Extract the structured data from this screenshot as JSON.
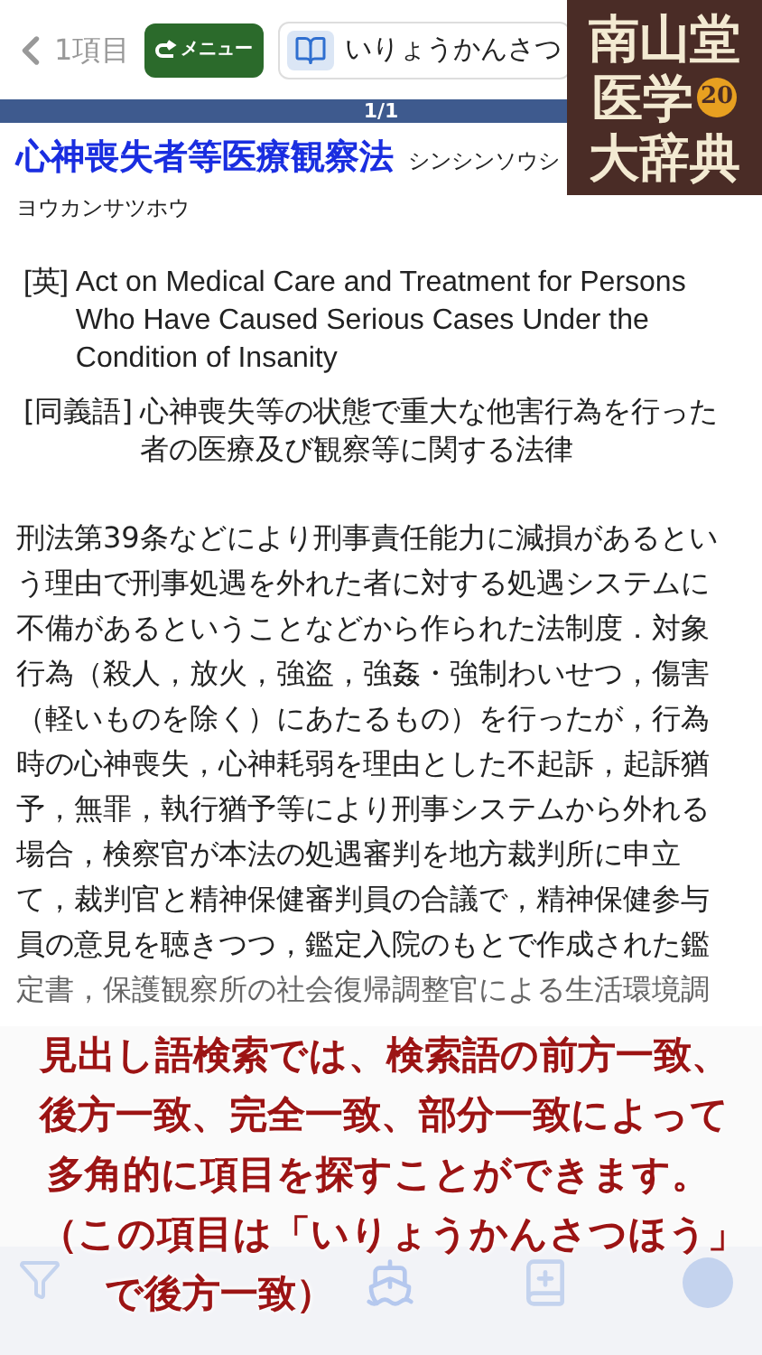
{
  "nav": {
    "back_label": "1項目",
    "menu_button": "メニュー",
    "search_value": "いりょうかんさつ"
  },
  "logo": {
    "line_1": "南山堂",
    "line_2": "医学",
    "edition": "20",
    "line_3": "大辞典"
  },
  "pager": {
    "label": "1/1"
  },
  "entry": {
    "title": "心神喪失者等医療観察法",
    "reading_start": "シンシンソウシ",
    "reading_end": "ヨウカンサツホウ",
    "english_tag": "[英]",
    "english": "Act on Medical Care and Treatment for Persons Who Have Caused Serious Cases Under the Condition of Insanity",
    "synonym_tag": "[同義語]",
    "synonym": "心神喪失等の状態で重大な他害行為を行った者の医療及び観察等に関する法律",
    "body_lines": [
      "刑法第39条などにより刑事責任能力に減損があるとい",
      "う理由で刑事処遇を外れた者に対する処遇システムに",
      "不備があるということなどから作られた法制度．対象",
      "行為（殺人，放火，強盗，強姦・強制わいせつ，傷害",
      "（軽いものを除く）にあたるもの）を行ったが，行為",
      "時の心神喪失，心神耗弱を理由とした不起訴，起訴猶",
      "予，無罪，執行猶予等により刑事システムから外れる",
      "場合，検察官が本法の処遇審判を地方裁判所に申立",
      "て，裁判官と精神保健審判員の合議で，精神保健参与",
      "員の意見を聴きつつ，鑑定入院のもとで作成された鑑",
      "定書，保護観察所の社会復帰調整官による生活環境調"
    ]
  },
  "caption": [
    "見出し語検索では、検索語の前方一致、",
    "後方一致、完全一致、部分一致によって",
    "多角的に項目を探すことができます。",
    "（この項目は「いりょうかんさつほう」",
    "で後方一致）"
  ]
}
